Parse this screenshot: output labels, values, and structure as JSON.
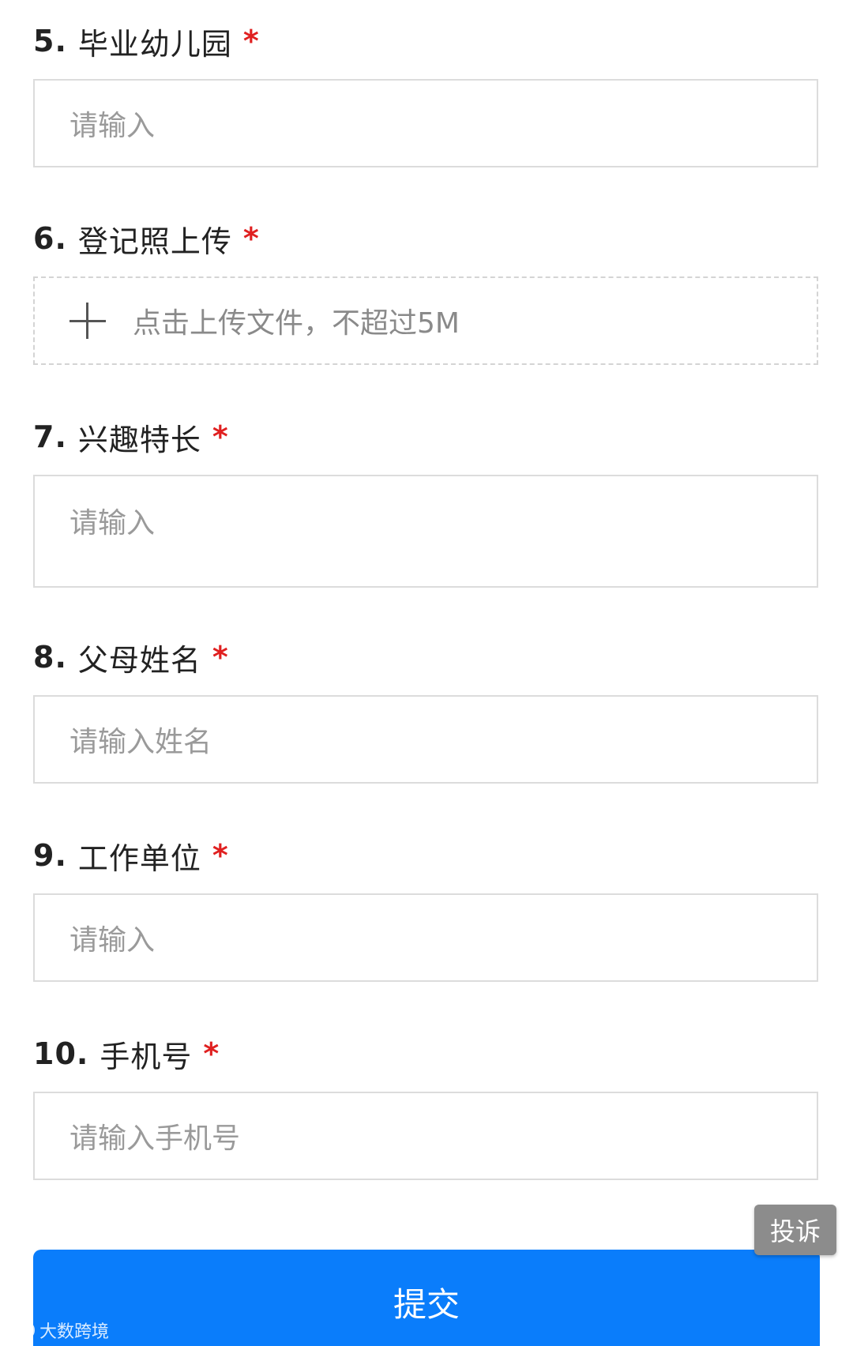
{
  "questions": [
    {
      "number": "5.",
      "label": "毕业幼儿园",
      "required": "*",
      "placeholder": "请输入"
    },
    {
      "number": "6.",
      "label": "登记照上传",
      "required": "*",
      "upload_text": "点击上传文件，不超过5M"
    },
    {
      "number": "7.",
      "label": "兴趣特长",
      "required": "*",
      "placeholder": "请输入"
    },
    {
      "number": "8.",
      "label": "父母姓名",
      "required": "*",
      "placeholder": "请输入姓名"
    },
    {
      "number": "9.",
      "label": "工作单位",
      "required": "*",
      "placeholder": "请输入"
    },
    {
      "number": "10.",
      "label": "手机号",
      "required": "*",
      "placeholder": "请输入手机号"
    }
  ],
  "actions": {
    "complain_label": "投诉",
    "submit_label": "提交"
  },
  "watermark": {
    "text": "大数跨境"
  },
  "colors": {
    "required_star": "#e02020",
    "submit_button": "#0a7dfb",
    "complain_button": "#8c8c8c"
  }
}
